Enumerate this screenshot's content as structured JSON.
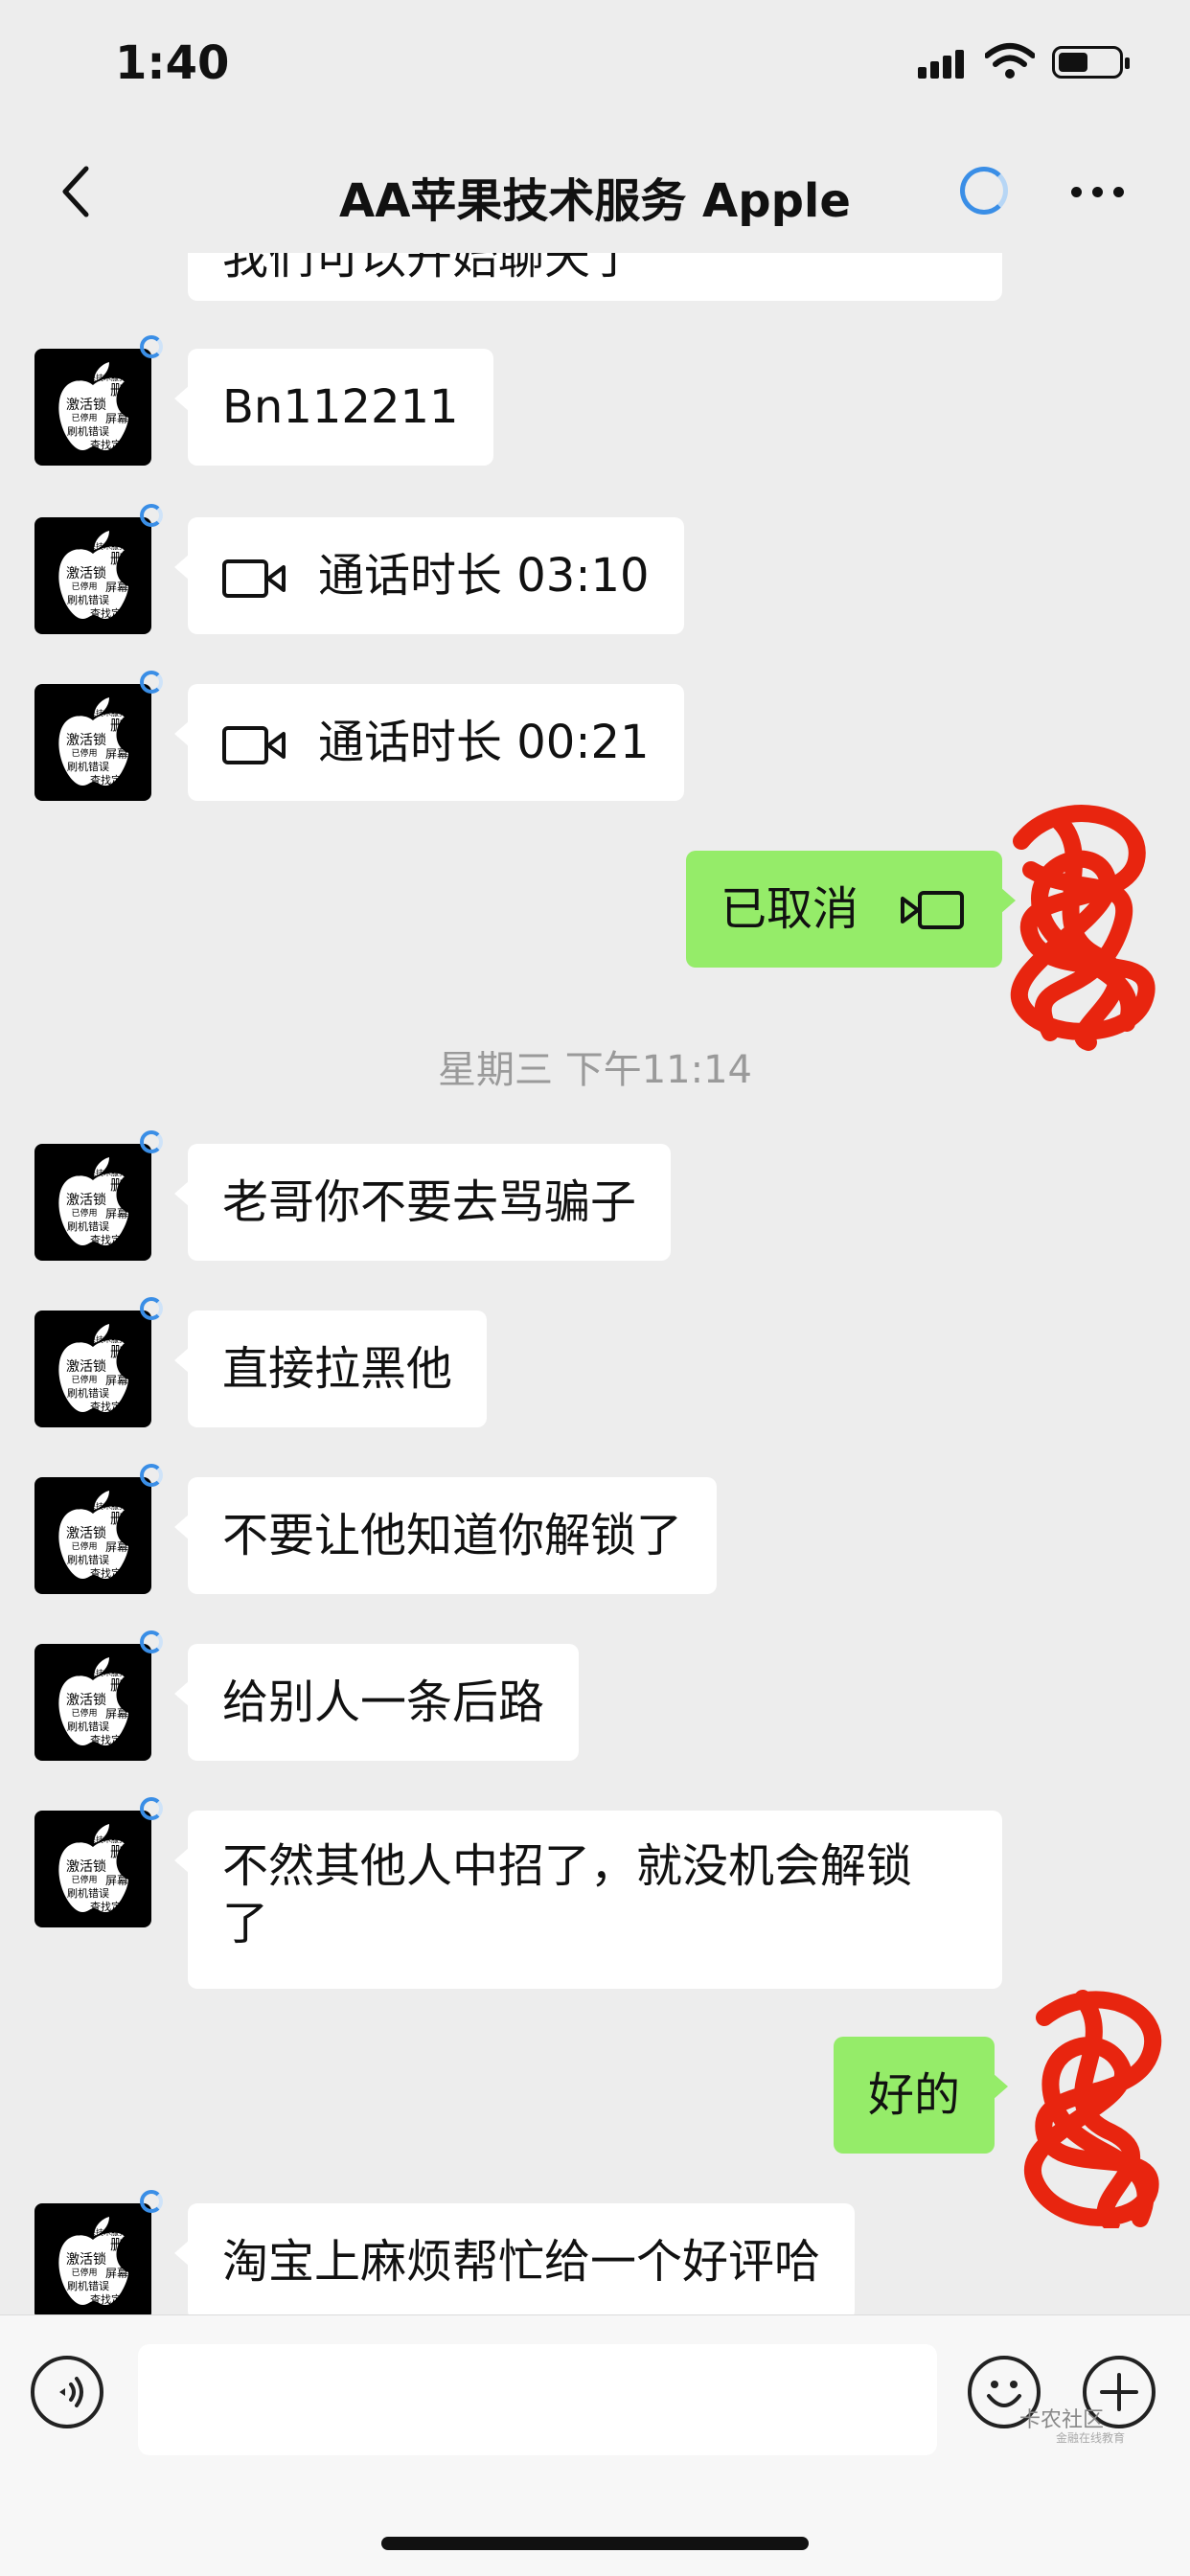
{
  "status_bar": {
    "time": "1:40"
  },
  "header": {
    "title": "AA苹果技术服务 Apple"
  },
  "avatar_text": {
    "line1": "专业苹果技术服务",
    "line2": "删除ID",
    "line3": "激活锁",
    "line4": "已停用",
    "line5": "屏幕锁",
    "line6": "刷机错误",
    "line7": "查找定位"
  },
  "messages": {
    "m0": {
      "text": "我们可以开始聊天了"
    },
    "m1": {
      "text": "Bn112211"
    },
    "m2": {
      "text": "通话时长 03:10"
    },
    "m3": {
      "text": "通话时长 00:21"
    },
    "m4": {
      "text": "已取消"
    },
    "ts": {
      "text": "星期三 下午11:14"
    },
    "m5": {
      "text": "老哥你不要去骂骗子"
    },
    "m6": {
      "text": "直接拉黑他"
    },
    "m7": {
      "text": "不要让他知道你解锁了"
    },
    "m8": {
      "text": "给别人一条后路"
    },
    "m9": {
      "line1": "不然其他人中招了，就没机会解锁",
      "line2": "了"
    },
    "m10": {
      "text": "好的"
    },
    "m11": {
      "text": "淘宝上麻烦帮忙给一个好评哈"
    }
  },
  "watermark": {
    "text": "卡农社区",
    "sub": "金融在线教育"
  },
  "colors": {
    "sent_bubble": "#95ec69",
    "received_bubble": "#ffffff",
    "background": "#ededed",
    "accent": "#3a8ee6",
    "scribble": "#e8250f"
  },
  "icons": {
    "back": "chevron-left-icon",
    "loading": "spinner-icon",
    "more": "more-dots-icon",
    "voice": "voice-icon",
    "emoji": "emoji-icon",
    "plus": "plus-icon",
    "video": "video-call-icon"
  }
}
